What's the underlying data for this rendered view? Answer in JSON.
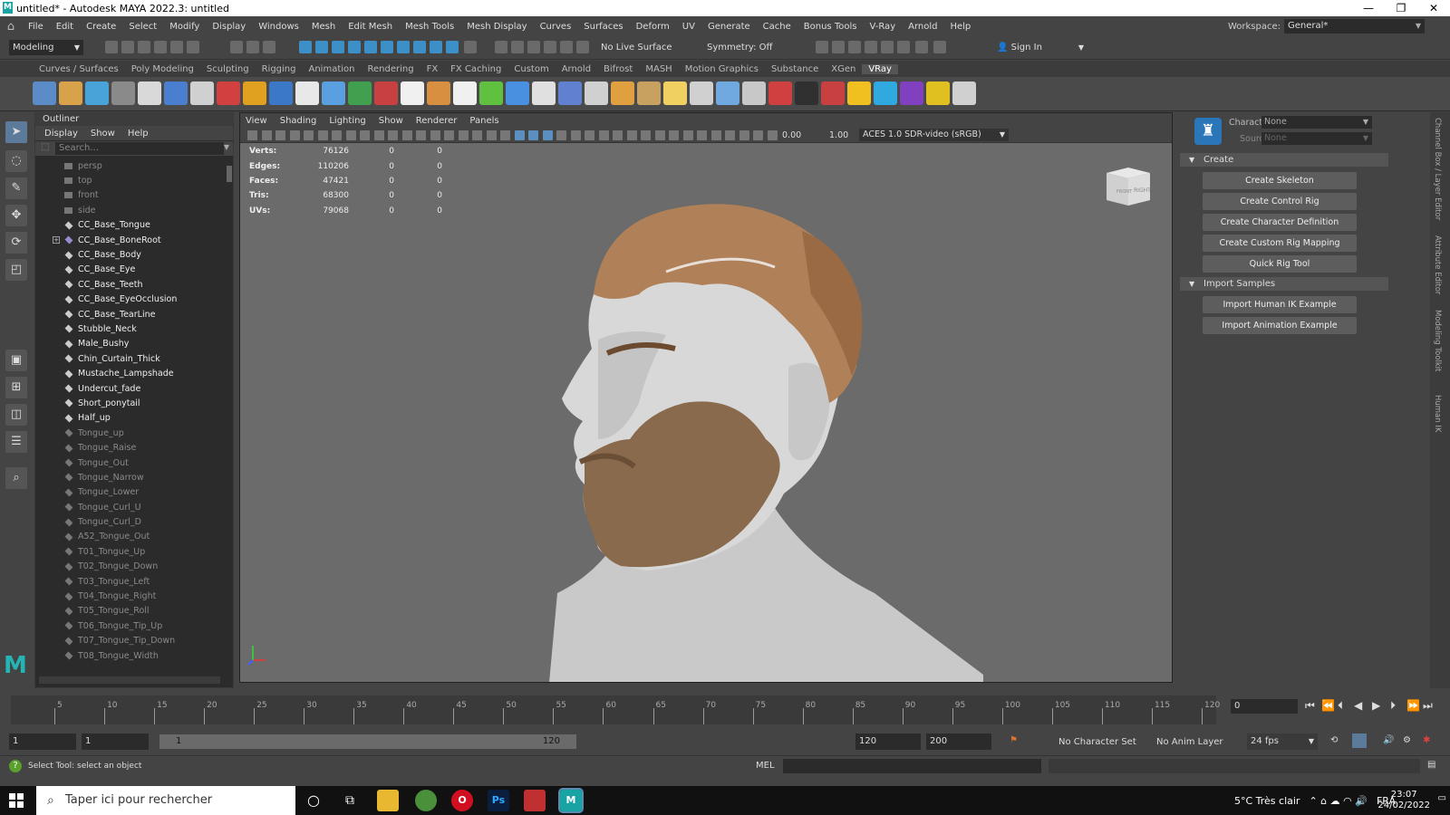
{
  "window": {
    "title": "untitled* - Autodesk MAYA 2022.3: untitled",
    "logo": "M",
    "minimize": "—",
    "restore": "❐",
    "close": "✕"
  },
  "menubar": {
    "items": [
      "File",
      "Edit",
      "Create",
      "Select",
      "Modify",
      "Display",
      "Windows",
      "Mesh",
      "Edit Mesh",
      "Mesh Tools",
      "Mesh Display",
      "Curves",
      "Surfaces",
      "Deform",
      "UV",
      "Generate",
      "Cache",
      "Bonus Tools",
      "V-Ray",
      "Arnold",
      "Help"
    ],
    "workspace_label": "Workspace:",
    "workspace_value": "General*"
  },
  "statusline": {
    "mode": "Modeling",
    "live_surface": "No Live Surface",
    "symmetry": "Symmetry: Off",
    "sign_in": "Sign In"
  },
  "shelf": {
    "tabs": [
      "Curves / Surfaces",
      "Poly Modeling",
      "Sculpting",
      "Rigging",
      "Animation",
      "Rendering",
      "FX",
      "FX Caching",
      "Custom",
      "Arnold",
      "Bifrost",
      "MASH",
      "Motion Graphics",
      "Substance",
      "XGen",
      "VRay"
    ],
    "active_tab": "VRay",
    "icon_colors": [
      "#5b8cc8",
      "#d8a24a",
      "#4aa3d8",
      "#8a8a8a",
      "#d9d9d9",
      "#4a7fcf",
      "#d0d0d0",
      "#d24040",
      "#e0a020",
      "#3c78c8",
      "#e8e8e8",
      "#5aa0e0",
      "#40a050",
      "#c84040",
      "#f0f0f0",
      "#d89040",
      "#f0f0f0",
      "#60c040",
      "#4a90e0",
      "#e0e0e0",
      "#6080d0",
      "#d0d0d0",
      "#e0a040",
      "#c8a060",
      "#f0d060",
      "#d0d0d0",
      "#70a8e0",
      "#c8c8c8",
      "#d04040",
      "#303030",
      "#c84040",
      "#f0c020",
      "#30a8e0",
      "#8040c0",
      "#e0c020",
      "#d0d0d0"
    ]
  },
  "outliner": {
    "title": "Outliner",
    "menu": [
      "Display",
      "Show",
      "Help"
    ],
    "search_placeholder": "Search...",
    "items": [
      {
        "label": "persp",
        "dim": true,
        "icon": "camera-icon"
      },
      {
        "label": "top",
        "dim": true,
        "icon": "camera-icon"
      },
      {
        "label": "front",
        "dim": true,
        "icon": "camera-icon"
      },
      {
        "label": "side",
        "dim": true,
        "icon": "camera-icon"
      },
      {
        "label": "CC_Base_Tongue",
        "dim": false,
        "icon": "mesh-icon"
      },
      {
        "label": "CC_Base_BoneRoot",
        "dim": false,
        "icon": "joint-icon",
        "expandable": true
      },
      {
        "label": "CC_Base_Body",
        "dim": false,
        "icon": "mesh-icon"
      },
      {
        "label": "CC_Base_Eye",
        "dim": false,
        "icon": "mesh-icon"
      },
      {
        "label": "CC_Base_Teeth",
        "dim": false,
        "icon": "mesh-icon"
      },
      {
        "label": "CC_Base_EyeOcclusion",
        "dim": false,
        "icon": "mesh-icon"
      },
      {
        "label": "CC_Base_TearLine",
        "dim": false,
        "icon": "mesh-icon"
      },
      {
        "label": "Stubble_Neck",
        "dim": false,
        "icon": "mesh-icon"
      },
      {
        "label": "Male_Bushy",
        "dim": false,
        "icon": "mesh-icon"
      },
      {
        "label": "Chin_Curtain_Thick",
        "dim": false,
        "icon": "mesh-icon"
      },
      {
        "label": "Mustache_Lampshade",
        "dim": false,
        "icon": "mesh-icon"
      },
      {
        "label": "Undercut_fade",
        "dim": false,
        "icon": "mesh-icon"
      },
      {
        "label": "Short_ponytail",
        "dim": false,
        "icon": "mesh-icon"
      },
      {
        "label": "Half_up",
        "dim": false,
        "icon": "mesh-icon"
      },
      {
        "label": "Tongue_up",
        "dim": true,
        "icon": "mesh-icon"
      },
      {
        "label": "Tongue_Raise",
        "dim": true,
        "icon": "mesh-icon"
      },
      {
        "label": "Tongue_Out",
        "dim": true,
        "icon": "mesh-icon"
      },
      {
        "label": "Tongue_Narrow",
        "dim": true,
        "icon": "mesh-icon"
      },
      {
        "label": "Tongue_Lower",
        "dim": true,
        "icon": "mesh-icon"
      },
      {
        "label": "Tongue_Curl_U",
        "dim": true,
        "icon": "mesh-icon"
      },
      {
        "label": "Tongue_Curl_D",
        "dim": true,
        "icon": "mesh-icon"
      },
      {
        "label": "A52_Tongue_Out",
        "dim": true,
        "icon": "mesh-icon"
      },
      {
        "label": "T01_Tongue_Up",
        "dim": true,
        "icon": "mesh-icon"
      },
      {
        "label": "T02_Tongue_Down",
        "dim": true,
        "icon": "mesh-icon"
      },
      {
        "label": "T03_Tongue_Left",
        "dim": true,
        "icon": "mesh-icon"
      },
      {
        "label": "T04_Tongue_Right",
        "dim": true,
        "icon": "mesh-icon"
      },
      {
        "label": "T05_Tongue_Roll",
        "dim": true,
        "icon": "mesh-icon"
      },
      {
        "label": "T06_Tongue_Tip_Up",
        "dim": true,
        "icon": "mesh-icon"
      },
      {
        "label": "T07_Tongue_Tip_Down",
        "dim": true,
        "icon": "mesh-icon"
      },
      {
        "label": "T08_Tongue_Width",
        "dim": true,
        "icon": "mesh-icon"
      }
    ]
  },
  "viewport": {
    "menu": [
      "View",
      "Shading",
      "Lighting",
      "Show",
      "Renderer",
      "Panels"
    ],
    "exposure": "0.00",
    "gamma": "1.00",
    "color_space": "ACES 1.0 SDR-video (sRGB)",
    "hud": [
      {
        "label": "Verts:",
        "value": "76126",
        "sel": "0",
        "comp": "0"
      },
      {
        "label": "Edges:",
        "value": "110206",
        "sel": "0",
        "comp": "0"
      },
      {
        "label": "Faces:",
        "value": "47421",
        "sel": "0",
        "comp": "0"
      },
      {
        "label": "Tris:",
        "value": "68300",
        "sel": "0",
        "comp": "0"
      },
      {
        "label": "UVs:",
        "value": "79068",
        "sel": "0",
        "comp": "0"
      }
    ],
    "viewcube_front": "FRONT",
    "viewcube_right": "RIGHT"
  },
  "humanik": {
    "character_label": "Character:",
    "character_value": "None",
    "source_label": "Source:",
    "source_value": "None",
    "create_section": "Create",
    "create_buttons": [
      "Create Skeleton",
      "Create Control Rig",
      "Create Character Definition",
      "Create Custom Rig Mapping",
      "Quick Rig Tool"
    ],
    "import_section": "Import Samples",
    "import_buttons": [
      "Import Human IK Example",
      "Import Animation Example"
    ]
  },
  "side_tabs": [
    "Channel Box / Layer Editor",
    "Attribute Editor",
    "Modeling Toolkit",
    "Human IK"
  ],
  "timeline": {
    "ticks": [
      "5",
      "10",
      "15",
      "20",
      "25",
      "30",
      "35",
      "40",
      "45",
      "50",
      "55",
      "60",
      "65",
      "70",
      "75",
      "80",
      "85",
      "90",
      "95",
      "100",
      "105",
      "110",
      "115",
      "120"
    ],
    "current_frame": "0"
  },
  "range": {
    "start": "1",
    "playback_start": "1",
    "slider_start": "1",
    "slider_end": "120",
    "playback_end": "120",
    "end": "200",
    "character_set": "No Character Set",
    "anim_layer": "No Anim Layer",
    "fps": "24 fps"
  },
  "helpline": {
    "text": "Select Tool: select an object",
    "mel": "MEL"
  },
  "taskbar": {
    "search_placeholder": "Taper ici pour rechercher",
    "weather": "5°C  Très clair",
    "lang": "FRA",
    "time": "23:07",
    "date": "24/02/2022"
  }
}
